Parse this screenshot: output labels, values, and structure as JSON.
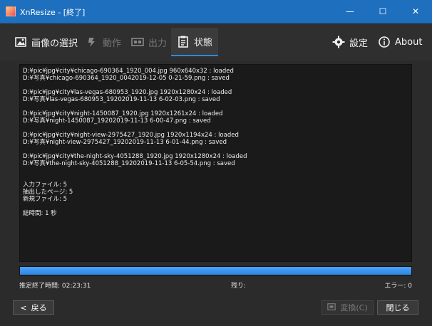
{
  "window": {
    "title": "XnResize - [終了]",
    "minimize_glyph": "—",
    "maximize_glyph": "☐",
    "close_glyph": "✕"
  },
  "toolbar": {
    "items": [
      {
        "label": "画像の選択",
        "icon": "image-select-icon"
      },
      {
        "label": "動作",
        "icon": "action-icon",
        "disabled": true
      },
      {
        "label": "出力",
        "icon": "output-icon",
        "disabled": true
      },
      {
        "label": "状態",
        "icon": "status-clipboard-icon",
        "active": true
      }
    ],
    "settings_label": "設定",
    "about_label": "About"
  },
  "log": {
    "lines": [
      "D:¥pic¥jpg¥city¥chicago-690364_1920_004.jpg 960x640x32 : loaded",
      "D:¥写真¥chicago-690364_1920_0042019-12-05 0-21-59.png : saved",
      "",
      "D:¥pic¥jpg¥city¥las-vegas-680953_1920.jpg 1920x1280x24 : loaded",
      "D:¥写真¥las-vegas-680953_19202019-11-13 6-02-03.png : saved",
      "",
      "D:¥pic¥jpg¥city¥night-1450087_1920.jpg 1920x1261x24 : loaded",
      "D:¥写真¥night-1450087_19202019-11-13 6-00-47.png : saved",
      "",
      "D:¥pic¥jpg¥city¥night-view-2975427_1920.jpg 1920x1194x24 : loaded",
      "D:¥写真¥night-view-2975427_19202019-11-13 6-01-44.png : saved",
      "",
      "D:¥pic¥jpg¥city¥the-night-sky-4051288_1920.jpg 1920x1280x24 : loaded",
      "D:¥写真¥the-night-sky-4051288_19202019-11-13 6-05-54.png : saved",
      "",
      "",
      "入力ファイル: 5",
      "抽出したページ: 5",
      "新規ファイル: 5",
      "",
      "総時間: 1 秒"
    ]
  },
  "progress": {
    "fraction": 1.0
  },
  "status": {
    "estimated_label": "推定終了時間:  02:23:31",
    "remaining_label": "残り:",
    "errors_label": "エラー:  0"
  },
  "buttons": {
    "back_label": "戻る",
    "back_glyph": "<",
    "convert_label": "変換(C)",
    "close_label": "閉じる"
  },
  "colors": {
    "titlebar": "#1f6fbf",
    "accent": "#2f8ad6",
    "progress": "#2f86e0"
  }
}
